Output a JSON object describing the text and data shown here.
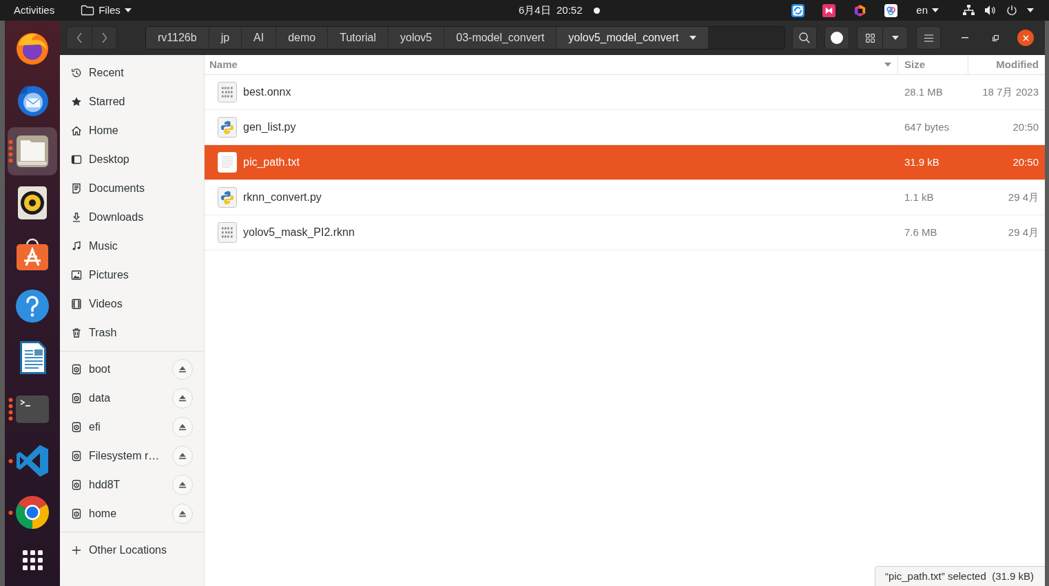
{
  "top_bar": {
    "activities": "Activities",
    "app_menu": "Files",
    "clock": "6月4日  20:52",
    "notification_dot": true,
    "language": "en"
  },
  "dock": {
    "apps": [
      {
        "kind": "fox",
        "running": false,
        "selected": false
      },
      {
        "kind": "mailbird",
        "running": false,
        "selected": false
      },
      {
        "kind": "folder",
        "running": true,
        "multiple": true,
        "selected": true
      },
      {
        "kind": "speaker",
        "running": false,
        "selected": false
      },
      {
        "kind": "store",
        "running": false,
        "selected": false
      },
      {
        "kind": "help",
        "running": false,
        "selected": false
      },
      {
        "kind": "document",
        "running": false,
        "selected": false
      },
      {
        "kind": "terminal",
        "running": true,
        "multiple": true,
        "selected": false
      },
      {
        "kind": "editor",
        "running": true,
        "multiple": false,
        "selected": false
      },
      {
        "kind": "browser",
        "running": true,
        "multiple": false,
        "selected": false
      }
    ]
  },
  "header_bar": {
    "path": [
      {
        "label": "rv1126b",
        "selected": false
      },
      {
        "label": "jp",
        "selected": false
      },
      {
        "label": "AI",
        "selected": false
      },
      {
        "label": "demo",
        "selected": false
      },
      {
        "label": "Tutorial",
        "selected": false
      },
      {
        "label": "yolov5",
        "selected": false
      },
      {
        "label": "03-model_convert",
        "selected": false
      },
      {
        "label": "yolov5_model_convert",
        "selected": true
      }
    ]
  },
  "sidebar": {
    "places": [
      {
        "label": "Recent",
        "kind": "recent",
        "selected": false
      },
      {
        "label": "Starred",
        "kind": "starred",
        "selected": false
      },
      {
        "label": "Home",
        "kind": "home",
        "selected": false
      },
      {
        "label": "Desktop",
        "kind": "desktop",
        "selected": false
      },
      {
        "label": "Documents",
        "kind": "documents",
        "selected": false
      },
      {
        "label": "Downloads",
        "kind": "downloads",
        "selected": false
      },
      {
        "label": "Music",
        "kind": "music",
        "selected": false
      },
      {
        "label": "Pictures",
        "kind": "pictures",
        "selected": false
      },
      {
        "label": "Videos",
        "kind": "videos",
        "selected": false
      },
      {
        "label": "Trash",
        "kind": "trash",
        "selected": false
      }
    ],
    "devices": [
      {
        "label": "boot",
        "selected": false
      },
      {
        "label": "data",
        "selected": false
      },
      {
        "label": "efi",
        "selected": false
      },
      {
        "label": "Filesystem r…",
        "selected": false
      },
      {
        "label": "hdd8T",
        "selected": false
      },
      {
        "label": "home",
        "selected": false
      }
    ],
    "other_locations": {
      "label": "Other Locations",
      "selected": false
    }
  },
  "file_list": {
    "columns": [
      {
        "label": "Name",
        "sorted": true
      },
      {
        "label": "Size",
        "sorted": false
      },
      {
        "label": "Modified",
        "sorted": false
      }
    ],
    "rows": [
      {
        "name": "best.onnx",
        "size": "28.1 MB",
        "modified": "18 7月 2023",
        "kind": "binary",
        "selected": false
      },
      {
        "name": "gen_list.py",
        "size": "647 bytes",
        "modified": "20:50",
        "kind": "python",
        "selected": false
      },
      {
        "name": "pic_path.txt",
        "size": "31.9 kB",
        "modified": "20:50",
        "kind": "text",
        "selected": true
      },
      {
        "name": "rknn_convert.py",
        "size": "1.1 kB",
        "modified": "29 4月",
        "kind": "python",
        "selected": false
      },
      {
        "name": "yolov5_mask_PI2.rknn",
        "size": "7.6 MB",
        "modified": "29 4月",
        "kind": "binary",
        "selected": false
      }
    ]
  },
  "status": "“pic_path.txt” selected  (31.9 kB)"
}
